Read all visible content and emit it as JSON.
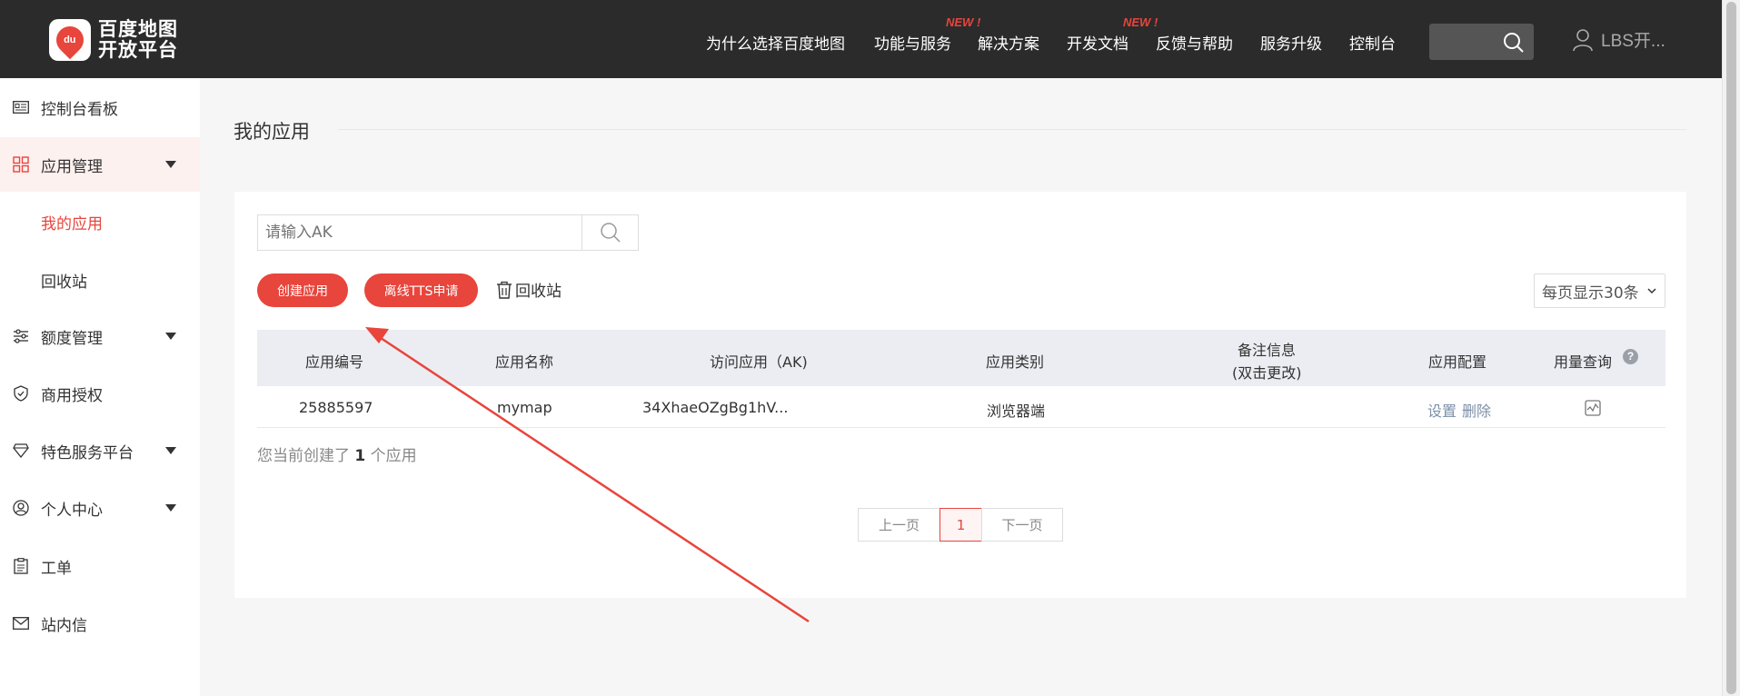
{
  "header": {
    "logo_line1": "百度地图",
    "logo_line2": "开放平台",
    "logo_mark": "du",
    "nav": [
      {
        "label": "为什么选择百度地图",
        "badge": ""
      },
      {
        "label": "功能与服务",
        "badge": "NEW !"
      },
      {
        "label": "解决方案",
        "badge": ""
      },
      {
        "label": "开发文档",
        "badge": "NEW !"
      },
      {
        "label": "反馈与帮助",
        "badge": ""
      },
      {
        "label": "服务升级",
        "badge": ""
      },
      {
        "label": "控制台",
        "badge": ""
      }
    ],
    "user": "LBS开..."
  },
  "sidebar": {
    "items": [
      {
        "label": "控制台看板",
        "icon": "dashboard-card-icon",
        "expandable": false
      },
      {
        "label": "应用管理",
        "icon": "grid-icon",
        "expandable": true
      },
      {
        "label": "额度管理",
        "icon": "sliders-icon",
        "expandable": true
      },
      {
        "label": "商用授权",
        "icon": "shield-check-icon",
        "expandable": false
      },
      {
        "label": "特色服务平台",
        "icon": "diamond-icon",
        "expandable": true
      },
      {
        "label": "个人中心",
        "icon": "user-circle-icon",
        "expandable": true
      },
      {
        "label": "工单",
        "icon": "clipboard-icon",
        "expandable": false
      },
      {
        "label": "站内信",
        "icon": "mail-icon",
        "expandable": false
      }
    ],
    "sub_items": [
      {
        "label": "我的应用",
        "active": true
      },
      {
        "label": "回收站",
        "active": false
      }
    ]
  },
  "main": {
    "title": "我的应用",
    "search": {
      "placeholder": "请输入AK",
      "value": ""
    },
    "buttons": {
      "create": "创建应用",
      "tts": "离线TTS申请",
      "recycle": "回收站"
    },
    "per_page": "每页显示30条",
    "table": {
      "headers": [
        "应用编号",
        "应用名称",
        "访问应用（AK)",
        "应用类别",
        "备注信息",
        "(双击更改)",
        "应用配置",
        "用量查询"
      ],
      "rows": [
        {
          "id": "25885597",
          "name": "mymap",
          "ak": "34XhaeOZgBg1hV...",
          "category": "浏览器端",
          "note": "",
          "config_set": "设置",
          "config_delete": "删除"
        }
      ]
    },
    "summary_prefix": "您当前创建了",
    "summary_count": "1",
    "summary_suffix": "个应用",
    "pager": {
      "prev": "上一页",
      "current": "1",
      "next": "下一页"
    }
  },
  "colors": {
    "brand_red": "#e8453c",
    "header_bg": "#2b2b2b",
    "annotation_arrow": "#e8453c"
  }
}
